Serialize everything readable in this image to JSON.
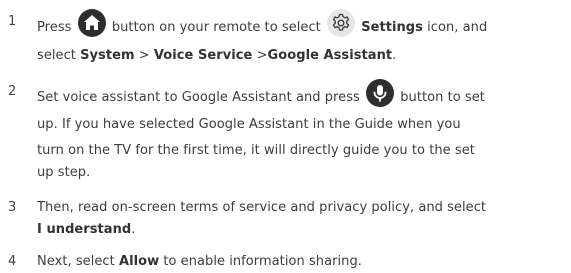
{
  "steps": [
    {
      "number": "1",
      "line1": {
        "before_home": "Press",
        "after_home": "button on your remote to select",
        "settings_bold": "Settings",
        "after_settings": "icon, and"
      },
      "line2": {
        "select": "select",
        "system": "System",
        "sep1": ">",
        "voice_service": "Voice Service",
        "sep2": ">",
        "google_assistant": "Google Assistant",
        "end": "."
      },
      "icons": [
        "home-icon",
        "gear-icon"
      ]
    },
    {
      "number": "2",
      "line1": {
        "before_mic": "Set voice assistant to Google Assistant and press",
        "after_mic": "button to set"
      },
      "line2": "up. If you have selected Google Assistant in the Guide when you",
      "line3": "turn on the TV for the first time, it will directly guide you to the set",
      "line4": "up step.",
      "icons": [
        "microphone-icon"
      ]
    },
    {
      "number": "3",
      "line1": "Then, read on-screen terms of service and privacy policy, and select",
      "line2": {
        "bold": "I understand",
        "end": "."
      }
    },
    {
      "number": "4",
      "line1": {
        "before": "Next, select",
        "bold": "Allow",
        "after": "to enable information sharing."
      }
    }
  ],
  "colors": {
    "text": "#3d3d3d",
    "icon_fill": "#2e2e2e",
    "gear_background": "#e6e6e6"
  }
}
